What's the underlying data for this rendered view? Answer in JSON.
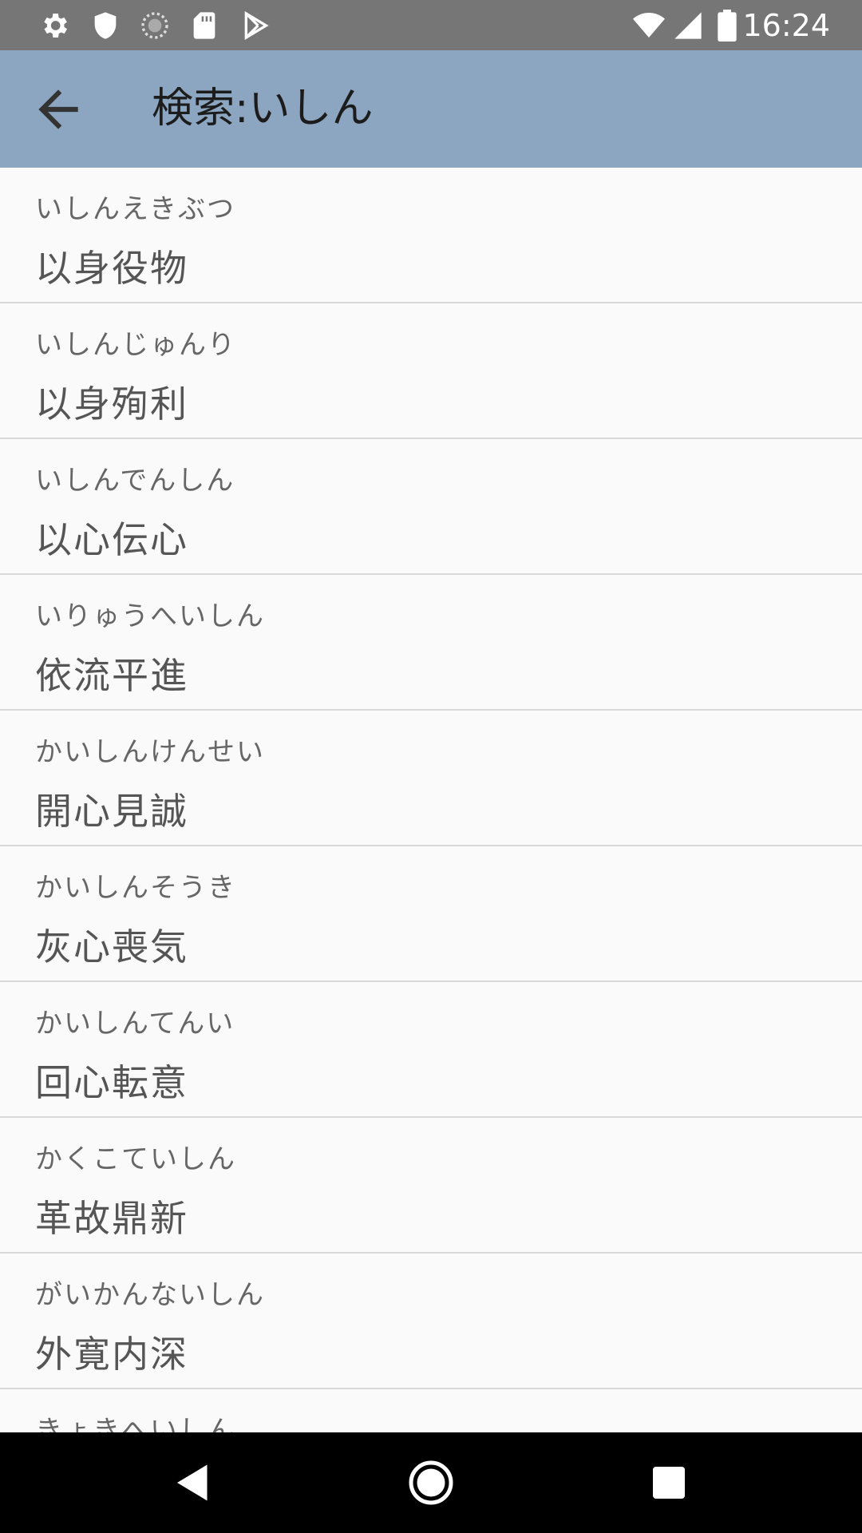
{
  "status_bar": {
    "time": "16:24",
    "icons": [
      "settings-icon",
      "shield-icon",
      "sync-icon",
      "sd-card-icon",
      "play-store-icon",
      "wifi-icon",
      "signal-icon",
      "battery-icon"
    ]
  },
  "app_bar": {
    "title": "検索:いしん",
    "back_icon": "arrow-back-icon"
  },
  "results": [
    {
      "reading": "いしんえきぶつ",
      "word": "以身役物"
    },
    {
      "reading": "いしんじゅんり",
      "word": "以身殉利"
    },
    {
      "reading": "いしんでんしん",
      "word": "以心伝心"
    },
    {
      "reading": "いりゅうへいしん",
      "word": "依流平進"
    },
    {
      "reading": "かいしんけんせい",
      "word": "開心見誠"
    },
    {
      "reading": "かいしんそうき",
      "word": "灰心喪気"
    },
    {
      "reading": "かいしんてんい",
      "word": "回心転意"
    },
    {
      "reading": "かくこていしん",
      "word": "革故鼎新"
    },
    {
      "reading": "がいかんないしん",
      "word": "外寛内深"
    },
    {
      "reading": "きょきへいしん",
      "word": ""
    }
  ],
  "nav_bar": {
    "icons": [
      "back-triangle-icon",
      "home-circle-icon",
      "recents-square-icon"
    ]
  },
  "colors": {
    "status_bar": "#767676",
    "app_bar": "#8ca6c2",
    "background": "#fafafa",
    "divider": "#d8d8d8"
  }
}
